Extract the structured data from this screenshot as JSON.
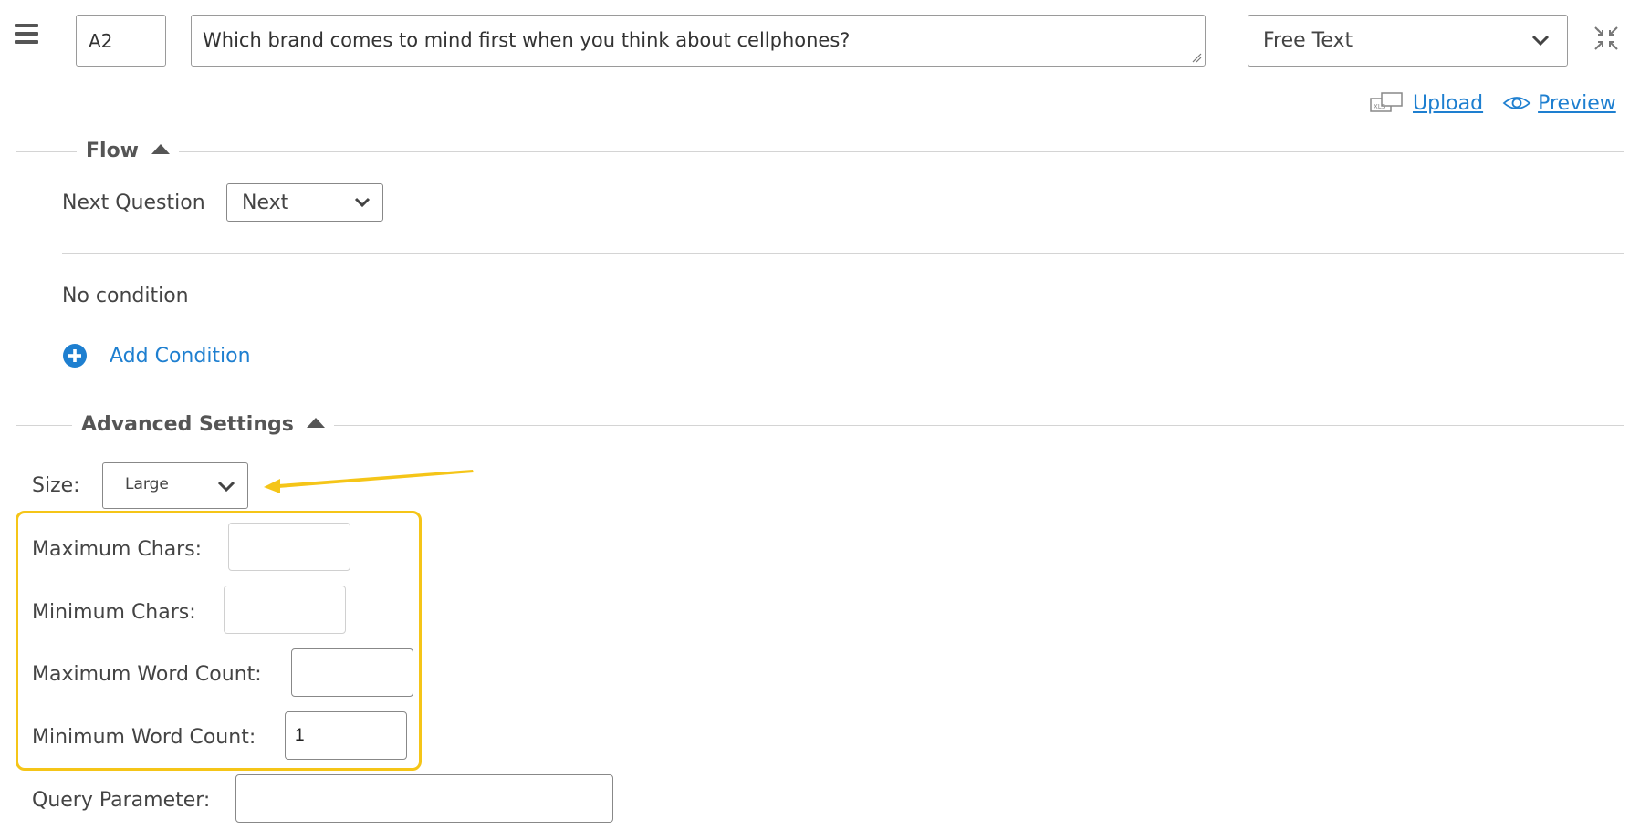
{
  "question": {
    "id": "A2",
    "text": "Which brand comes to mind first when you think about cellphones?",
    "type": "Free Text"
  },
  "actions": {
    "upload": "Upload",
    "preview": "Preview"
  },
  "flow": {
    "title": "Flow",
    "next_question_label": "Next Question",
    "next_question_value": "Next",
    "no_condition": "No condition",
    "add_condition": "Add Condition"
  },
  "advanced": {
    "title": "Advanced Settings",
    "size_label": "Size:",
    "size_value": "Large",
    "max_chars_label": "Maximum Chars:",
    "max_chars_value": "",
    "min_chars_label": "Minimum Chars:",
    "min_chars_value": "",
    "max_words_label": "Maximum Word Count:",
    "max_words_value": "",
    "min_words_label": "Minimum Word Count:",
    "min_words_value": "1",
    "query_param_label": "Query Parameter:",
    "query_param_value": ""
  },
  "colors": {
    "link": "#1e7fd0",
    "highlight": "#f5c518",
    "add_icon": "#1e7fd0"
  },
  "icons": [
    "hamburger-menu-icon",
    "resize-grip-icon",
    "chevron-down-icon",
    "collapse-icon",
    "upload-icon",
    "eye-icon",
    "plus-circle-icon",
    "caret-up-icon",
    "annotation-arrow"
  ]
}
